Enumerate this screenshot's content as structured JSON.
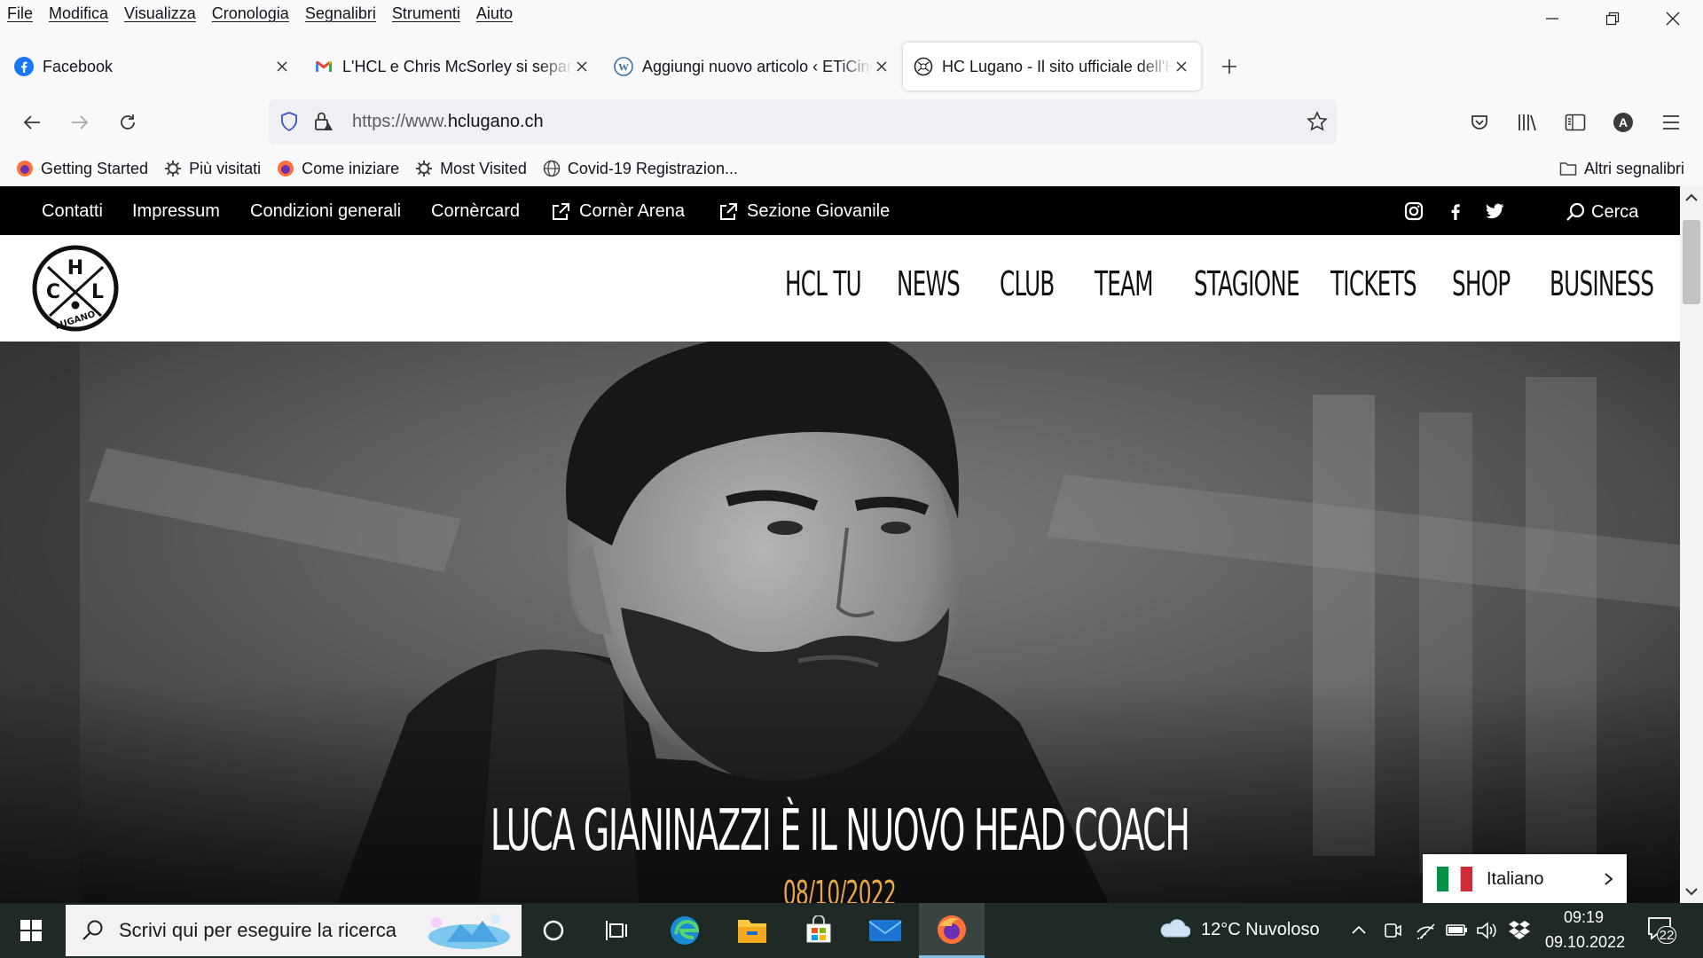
{
  "menubar": {
    "items": [
      "File",
      "Modifica",
      "Visualizza",
      "Cronologia",
      "Segnalibri",
      "Strumenti",
      "Aiuto"
    ]
  },
  "tabs": [
    {
      "title": "Facebook",
      "icon": "facebook-icon",
      "active": false
    },
    {
      "title": "L'HCL e Chris McSorley si separano",
      "icon": "gmail-icon",
      "active": false
    },
    {
      "title": "Aggiungi nuovo articolo ‹ ETiCinema",
      "icon": "wordpress-icon",
      "active": false
    },
    {
      "title": "HC Lugano - Il sito ufficiale dell'HCL",
      "icon": "hcl-icon",
      "active": true
    }
  ],
  "urlbar": {
    "prefix": "https://www.",
    "domain": "hclugano.ch"
  },
  "bookmarks": [
    {
      "label": "Getting Started",
      "icon": "firefox-icon"
    },
    {
      "label": "Più visitati",
      "icon": "gear-icon"
    },
    {
      "label": "Come iniziare",
      "icon": "firefox-icon"
    },
    {
      "label": "Most Visited",
      "icon": "gear-icon"
    },
    {
      "label": "Covid-19 Registrazion...",
      "icon": "globe-icon"
    }
  ],
  "bookmarks_other": "Altri segnalibri",
  "site": {
    "toplinks": [
      "Contatti",
      "Impressum",
      "Condizioni generali",
      "Cornèrcard",
      "Cornèr Arena",
      "Sezione Giovanile"
    ],
    "search_label": "Cerca",
    "nav": [
      "HCL TU",
      "NEWS",
      "CLUB",
      "TEAM",
      "STAGIONE",
      "TICKETS",
      "SHOP",
      "BUSINESS"
    ],
    "logo_letters": {
      "h": "H",
      "c": "C",
      "l": "L",
      "town": "LUGANO"
    },
    "hero": {
      "headline": "LUCA GIANINAZZI È IL NUOVO HEAD COACH",
      "date": "08/10/2022"
    },
    "language": "Italiano"
  },
  "taskbar": {
    "search_placeholder": "Scrivi qui per eseguire la ricerca",
    "weather": "12°C  Nuvoloso",
    "time": "09:19",
    "date": "09.10.2022",
    "notifications": "22"
  },
  "colors": {
    "accent_date": "#e8a84a",
    "topstrip": "#000000",
    "taskbar": "#1f2a26"
  }
}
